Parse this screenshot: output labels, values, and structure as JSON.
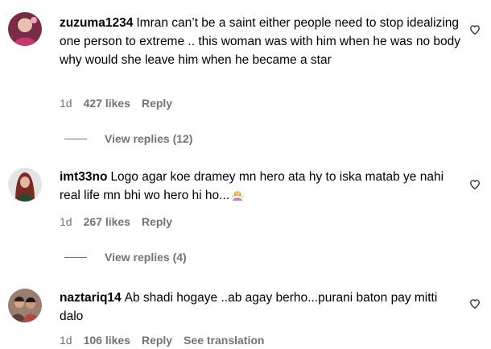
{
  "comments": [
    {
      "username": "zuzuma1234",
      "text": "Imran can’t be a saint either people need to stop idealizing one person to extreme .. this woman was with him when he was no body why would she leave him when he became a star",
      "age": "1d",
      "likes": "427 likes",
      "reply_label": "Reply",
      "view_replies": "View replies (12)",
      "like_icon": "heart-outline-icon",
      "avatar": "avatar-zuzuma1234"
    },
    {
      "username": "imt33no",
      "text": "Logo agar koe dramey mn hero ata hy to iska matab ye nahi real life mn bhi wo hero hi ho...",
      "emoji": "woman-shrugging-emoji",
      "age": "1d",
      "likes": "267 likes",
      "reply_label": "Reply",
      "view_replies": "View replies (4)",
      "like_icon": "heart-outline-icon",
      "avatar": "avatar-imt33no"
    },
    {
      "username": "naztariq14",
      "text": "Ab shadi hogaye ..ab agay berho...purani baton pay mitti dalo",
      "age": "1d",
      "likes": "106 likes",
      "reply_label": "Reply",
      "see_translation": "See translation",
      "like_icon": "heart-outline-icon",
      "avatar": "avatar-naztariq14"
    }
  ],
  "colors": {
    "text": "#000000",
    "secondary": "#737373",
    "background": "#ffffff"
  }
}
